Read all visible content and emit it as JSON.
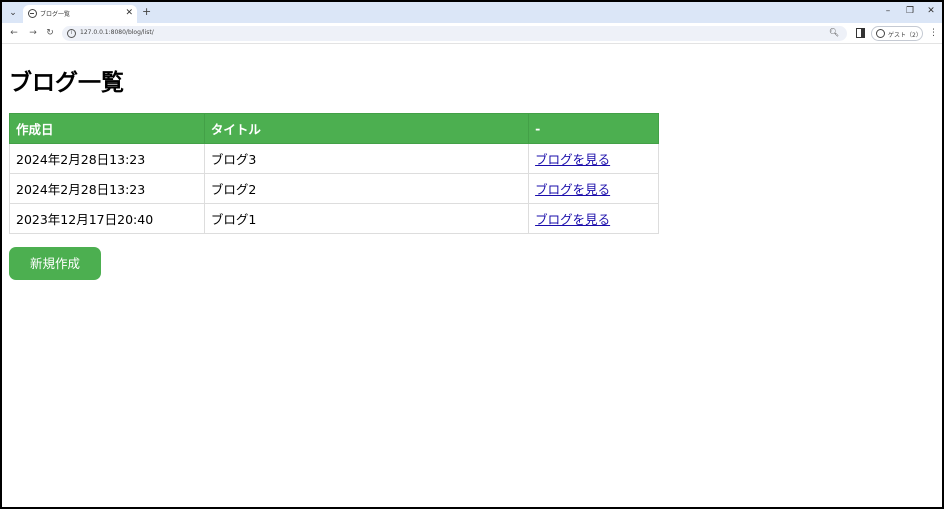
{
  "browser": {
    "tab_title": "ブログ一覧",
    "url": "127.0.0.1:8080/blog/list/",
    "profile_label": "ゲスト（2）"
  },
  "page": {
    "title": "ブログ一覧",
    "table": {
      "headers": [
        "作成日",
        "タイトル",
        "-"
      ],
      "rows": [
        {
          "date": "2024年2月28日13:23",
          "title": "ブログ3",
          "link": "ブログを見る"
        },
        {
          "date": "2024年2月28日13:23",
          "title": "ブログ2",
          "link": "ブログを見る"
        },
        {
          "date": "2023年12月17日20:40",
          "title": "ブログ1",
          "link": "ブログを見る"
        }
      ]
    },
    "new_button_label": "新規作成"
  },
  "colors": {
    "accent": "#4caf50",
    "link": "#1a0dab",
    "tabstrip": "#dbe6f7"
  }
}
